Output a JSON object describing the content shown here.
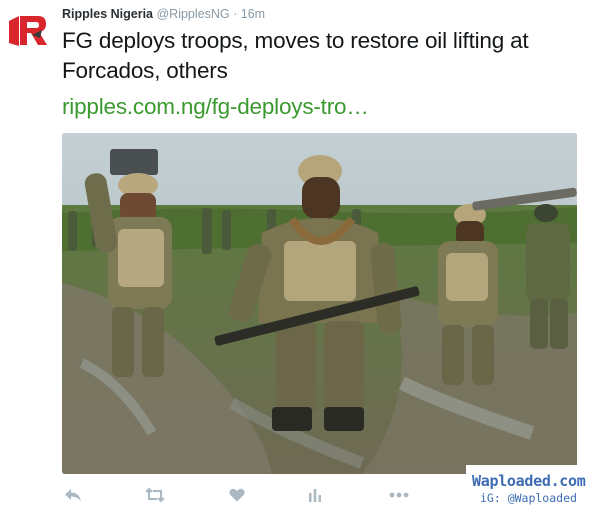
{
  "tweet": {
    "author_name": "Ripples Nigeria",
    "handle": "@RipplesNG",
    "separator": "·",
    "time": "16m",
    "text": "FG deploys troops, moves to restore oil lifting at Forcados, others",
    "link": "ripples.com.ng/fg-deploys-tro…",
    "avatar_icon": "ripples-logo-icon",
    "link_color": "#3b9a2f",
    "media_icon": "photo-soldiers-marching-in-mud"
  },
  "actions": [
    {
      "name": "reply",
      "icon": "reply-icon"
    },
    {
      "name": "retweet",
      "icon": "retweet-icon"
    },
    {
      "name": "like",
      "icon": "heart-icon"
    },
    {
      "name": "analytics",
      "icon": "bar-chart-icon"
    },
    {
      "name": "more",
      "icon": "more-dots-icon"
    }
  ],
  "watermark": {
    "main": "Waploaded.com",
    "sub": "iG: @Waploaded"
  }
}
